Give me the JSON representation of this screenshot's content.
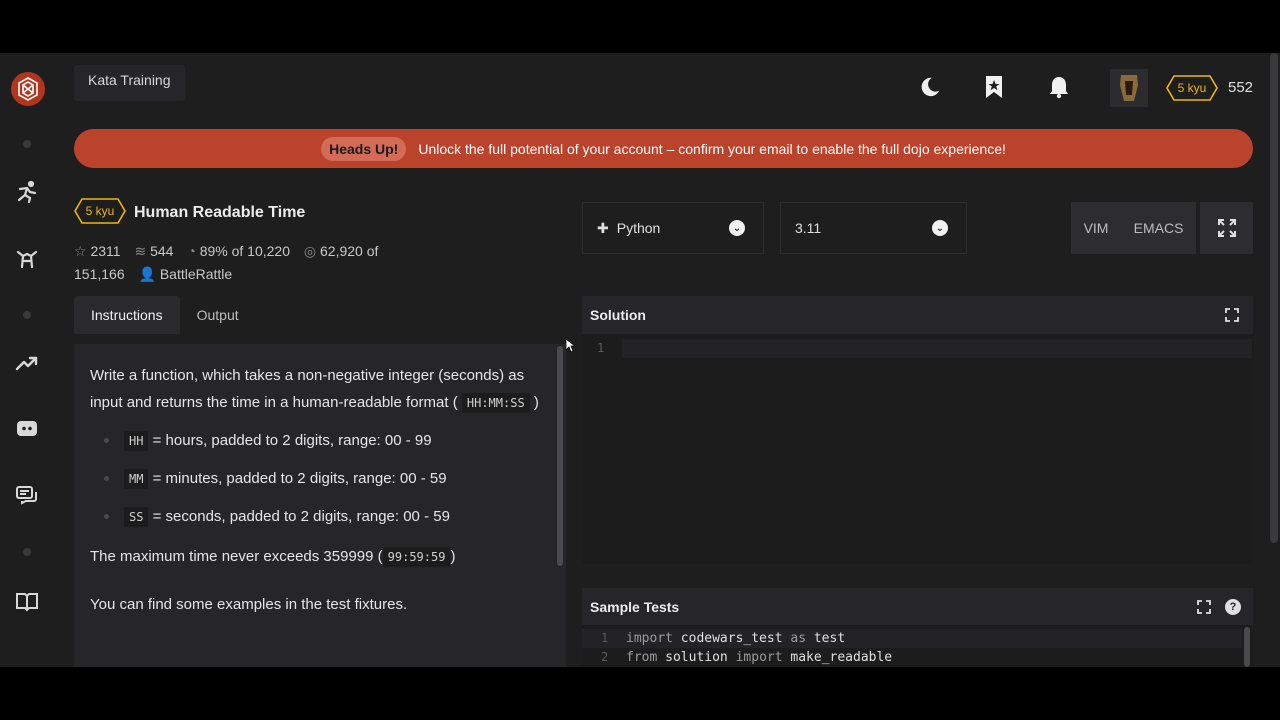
{
  "topbar": {
    "title": "Kata Training",
    "rank_badge": "5 kyu",
    "honor": "552"
  },
  "banner": {
    "tag": "Heads Up!",
    "message": "Unlock the full potential of your account – confirm your email to enable the full dojo experience!"
  },
  "kata": {
    "rank": "5 kyu",
    "title": "Human Readable Time",
    "stars": "2311",
    "collections": "544",
    "satisfaction": "89%",
    "satisfaction_of": "of 10,220",
    "completions": "62,920",
    "completions_of": "of",
    "completions_total": "151,166",
    "author": "BattleRattle"
  },
  "tabs": [
    "Instructions",
    "Output"
  ],
  "instructions": {
    "p1": "Write a function, which takes a non-negative integer (seconds) as input and returns the time in a human-readable format (",
    "p1_code": "HH:MM:SS",
    "p1_end": ")",
    "bullets": [
      {
        "code": "HH",
        "text": "= hours, padded to 2 digits, range: 00 - 99"
      },
      {
        "code": "MM",
        "text": "= minutes, padded to 2 digits, range: 00 - 59"
      },
      {
        "code": "SS",
        "text": "= seconds, padded to 2 digits, range: 00 - 59"
      }
    ],
    "p2": "The maximum time never exceeds 359999 (",
    "p2_code": "99:59:59",
    "p2_end": ")",
    "p3": "You can find some examples in the test fixtures."
  },
  "language": {
    "selected": "Python"
  },
  "version": {
    "selected": "3.11"
  },
  "modes": {
    "vim": "VIM",
    "emacs": "EMACS"
  },
  "solution": {
    "title": "Solution",
    "line1": "1"
  },
  "sample_tests": {
    "title": "Sample Tests",
    "lines": [
      {
        "n": "1",
        "kw1": "import",
        "a": " codewars_test ",
        "kw2": "as",
        "b": " test"
      },
      {
        "n": "2",
        "kw1": "from",
        "a": " solution ",
        "kw2": "import",
        "b": " make_readable"
      }
    ]
  },
  "colors": {
    "accent_red": "#bb432c",
    "kyu_yellow": "#ecb613",
    "bg": "#1e1e1f"
  }
}
